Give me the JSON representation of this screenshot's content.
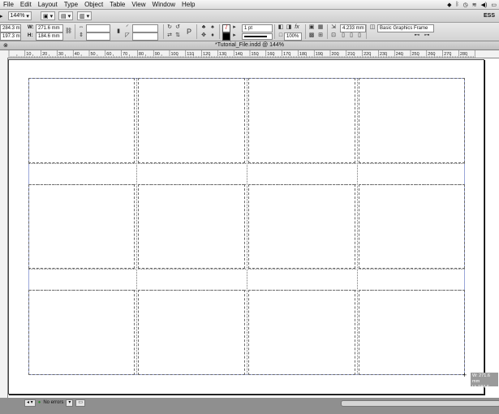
{
  "menubar": {
    "items": [
      "File",
      "Edit",
      "Layout",
      "Type",
      "Object",
      "Table",
      "View",
      "Window",
      "Help"
    ]
  },
  "appbar": {
    "zoom": "144%",
    "workspace": "ESS"
  },
  "control": {
    "x_label": "X:",
    "x_value": "284.3 mm",
    "y_label": "Y:",
    "y_value": "197.3 mm",
    "w_label": "W:",
    "w_value": "271.6 mm",
    "h_label": "H:",
    "h_value": "184.6 mm",
    "stroke_weight": "1 pt",
    "opacity": "100%",
    "offset_value": "4.233 mm",
    "object_style": "Basic Graphics Frame"
  },
  "document": {
    "title": "*Tutorial_File.indd @ 144%"
  },
  "ruler": {
    "labels": [
      "10",
      "20",
      "30",
      "40",
      "50",
      "60",
      "70",
      "80",
      "90",
      "100",
      "110",
      "120",
      "130",
      "140",
      "150",
      "160",
      "170",
      "180",
      "190",
      "200",
      "210",
      "220",
      "230",
      "240",
      "250",
      "260",
      "270",
      "280"
    ]
  },
  "tooltip": {
    "line1": "W: 271.6 mm",
    "line2": "H: 184.6 mm"
  },
  "status": {
    "preflight": "No errors"
  },
  "colors": {
    "margin_guide": "#9aa6d8",
    "frame_stroke": "#6a6a6a"
  }
}
